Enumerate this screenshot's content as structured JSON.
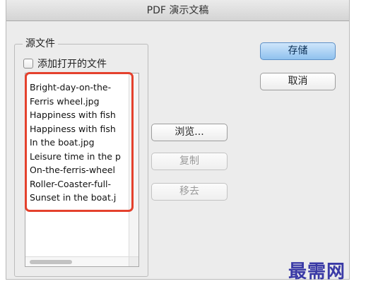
{
  "window": {
    "title": "PDF 演示文稿"
  },
  "source_group": {
    "legend": "源文件",
    "add_open_files_label": "添加打开的文件",
    "files": [
      "Bright-day-on-the-",
      "Ferris wheel.jpg",
      "Happiness with fish",
      "Happiness with fish",
      "In the boat.jpg",
      "Leisure time in the p",
      "On-the-ferris-wheel",
      "Roller-Coaster-full-",
      "Sunset in the boat.j"
    ]
  },
  "buttons": {
    "browse": "浏览...",
    "duplicate": "复制",
    "remove": "移去",
    "save": "存储",
    "cancel": "取消"
  },
  "watermark": "最需网",
  "colors": {
    "highlight": "#e4412d",
    "primary_button": "#8fc1ee",
    "watermark": "#3a3aa6"
  }
}
